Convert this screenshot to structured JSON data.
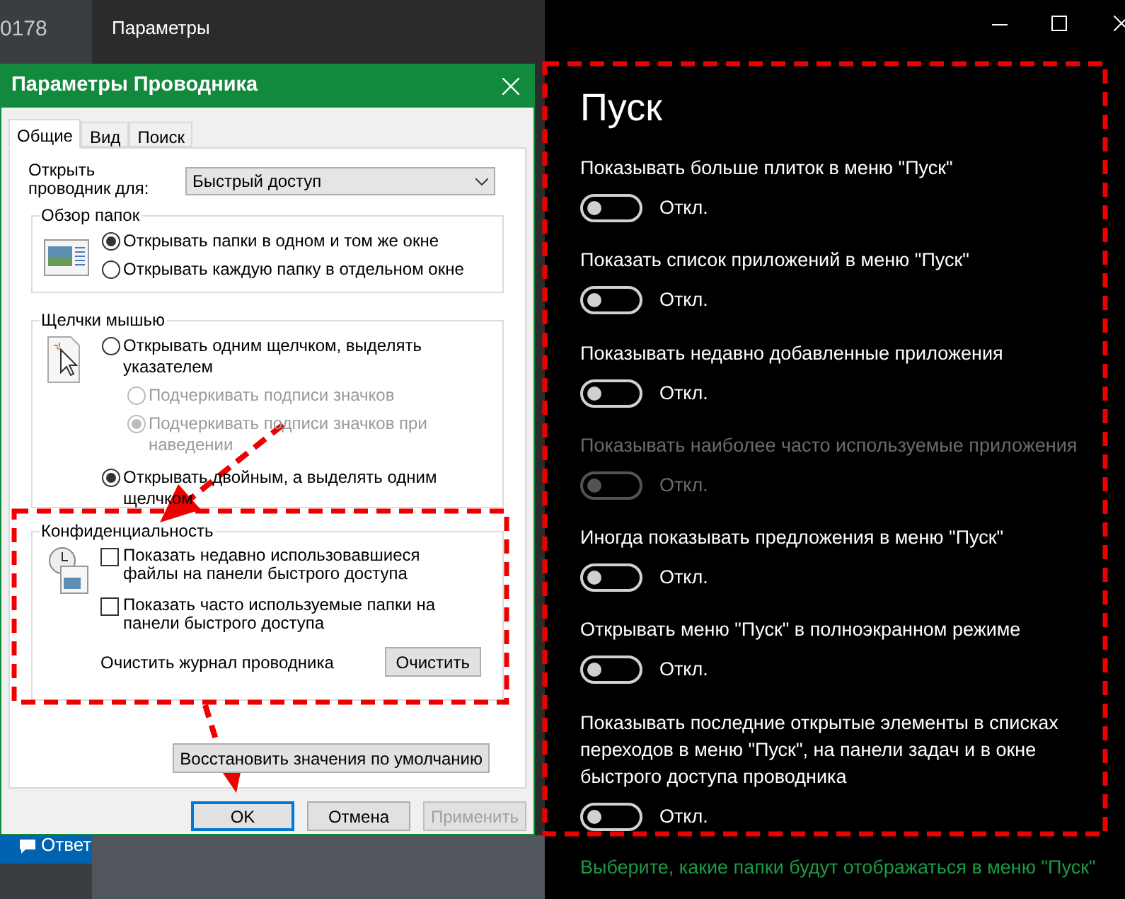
{
  "background_window": {
    "label": "0178",
    "button": "Ответ"
  },
  "settings_window": {
    "title": "Параметры",
    "heading": "Пуск",
    "options": [
      {
        "label": "Показывать больше плиток в меню \"Пуск\"",
        "state_text": "Откл.",
        "on": false,
        "disabled": false
      },
      {
        "label": "Показать список приложений в меню \"Пуск\"",
        "state_text": "Откл.",
        "on": false,
        "disabled": false
      },
      {
        "label": "Показывать недавно добавленные приложения",
        "state_text": "Откл.",
        "on": false,
        "disabled": false
      },
      {
        "label": "Показывать наиболее часто используемые приложения",
        "state_text": "Откл.",
        "on": false,
        "disabled": true
      },
      {
        "label": "Иногда показывать предложения в меню \"Пуск\"",
        "state_text": "Откл.",
        "on": false,
        "disabled": false
      },
      {
        "label": "Открывать меню \"Пуск\" в полноэкранном режиме",
        "state_text": "Откл.",
        "on": false,
        "disabled": false
      },
      {
        "label": "Показывать последние открытые элементы в списках переходов в меню \"Пуск\", на панели задач и в окне быстрого доступа проводника",
        "state_text": "Откл.",
        "on": false,
        "disabled": false
      }
    ],
    "link": "Выберите, какие папки будут отображаться в меню \"Пуск\""
  },
  "dialog": {
    "title": "Параметры Проводника",
    "tabs": [
      {
        "label": "Общие",
        "selected": true
      },
      {
        "label": "Вид",
        "selected": false
      },
      {
        "label": "Поиск",
        "selected": false
      }
    ],
    "open_for": {
      "label": "Открыть проводник для:",
      "value": "Быстрый доступ"
    },
    "folder_group": {
      "title": "Обзор папок",
      "radios": [
        {
          "label": "Открывать папки в одном и том же окне",
          "selected": true,
          "disabled": false
        },
        {
          "label": "Открывать каждую папку в отдельном окне",
          "selected": false,
          "disabled": false
        }
      ]
    },
    "click_group": {
      "title": "Щелчки мышью",
      "radios": [
        {
          "label": "Открывать одним щелчком, выделять указателем",
          "selected": false,
          "disabled": false,
          "children": [
            {
              "label": "Подчеркивать подписи значков",
              "selected": false,
              "disabled": true
            },
            {
              "label": "Подчеркивать подписи значков при наведении",
              "selected": true,
              "disabled": true
            }
          ]
        },
        {
          "label": "Открывать двойным, а выделять одним щелчком",
          "selected": true,
          "disabled": false
        }
      ]
    },
    "privacy_group": {
      "title": "Конфиденциальность",
      "checkboxes": [
        {
          "label": "Показать недавно использовавшиеся файлы на панели быстрого доступа",
          "checked": false
        },
        {
          "label": "Показать часто используемые папки на панели быстрого доступа",
          "checked": false
        }
      ],
      "clear_label": "Очистить журнал проводника",
      "clear_button": "Очистить"
    },
    "restore_button": "Восстановить значения по умолчанию",
    "buttons": [
      {
        "label": "OK",
        "default": true,
        "disabled": false
      },
      {
        "label": "Отмена",
        "default": false,
        "disabled": false
      },
      {
        "label": "Применить",
        "default": false,
        "disabled": true
      }
    ]
  }
}
